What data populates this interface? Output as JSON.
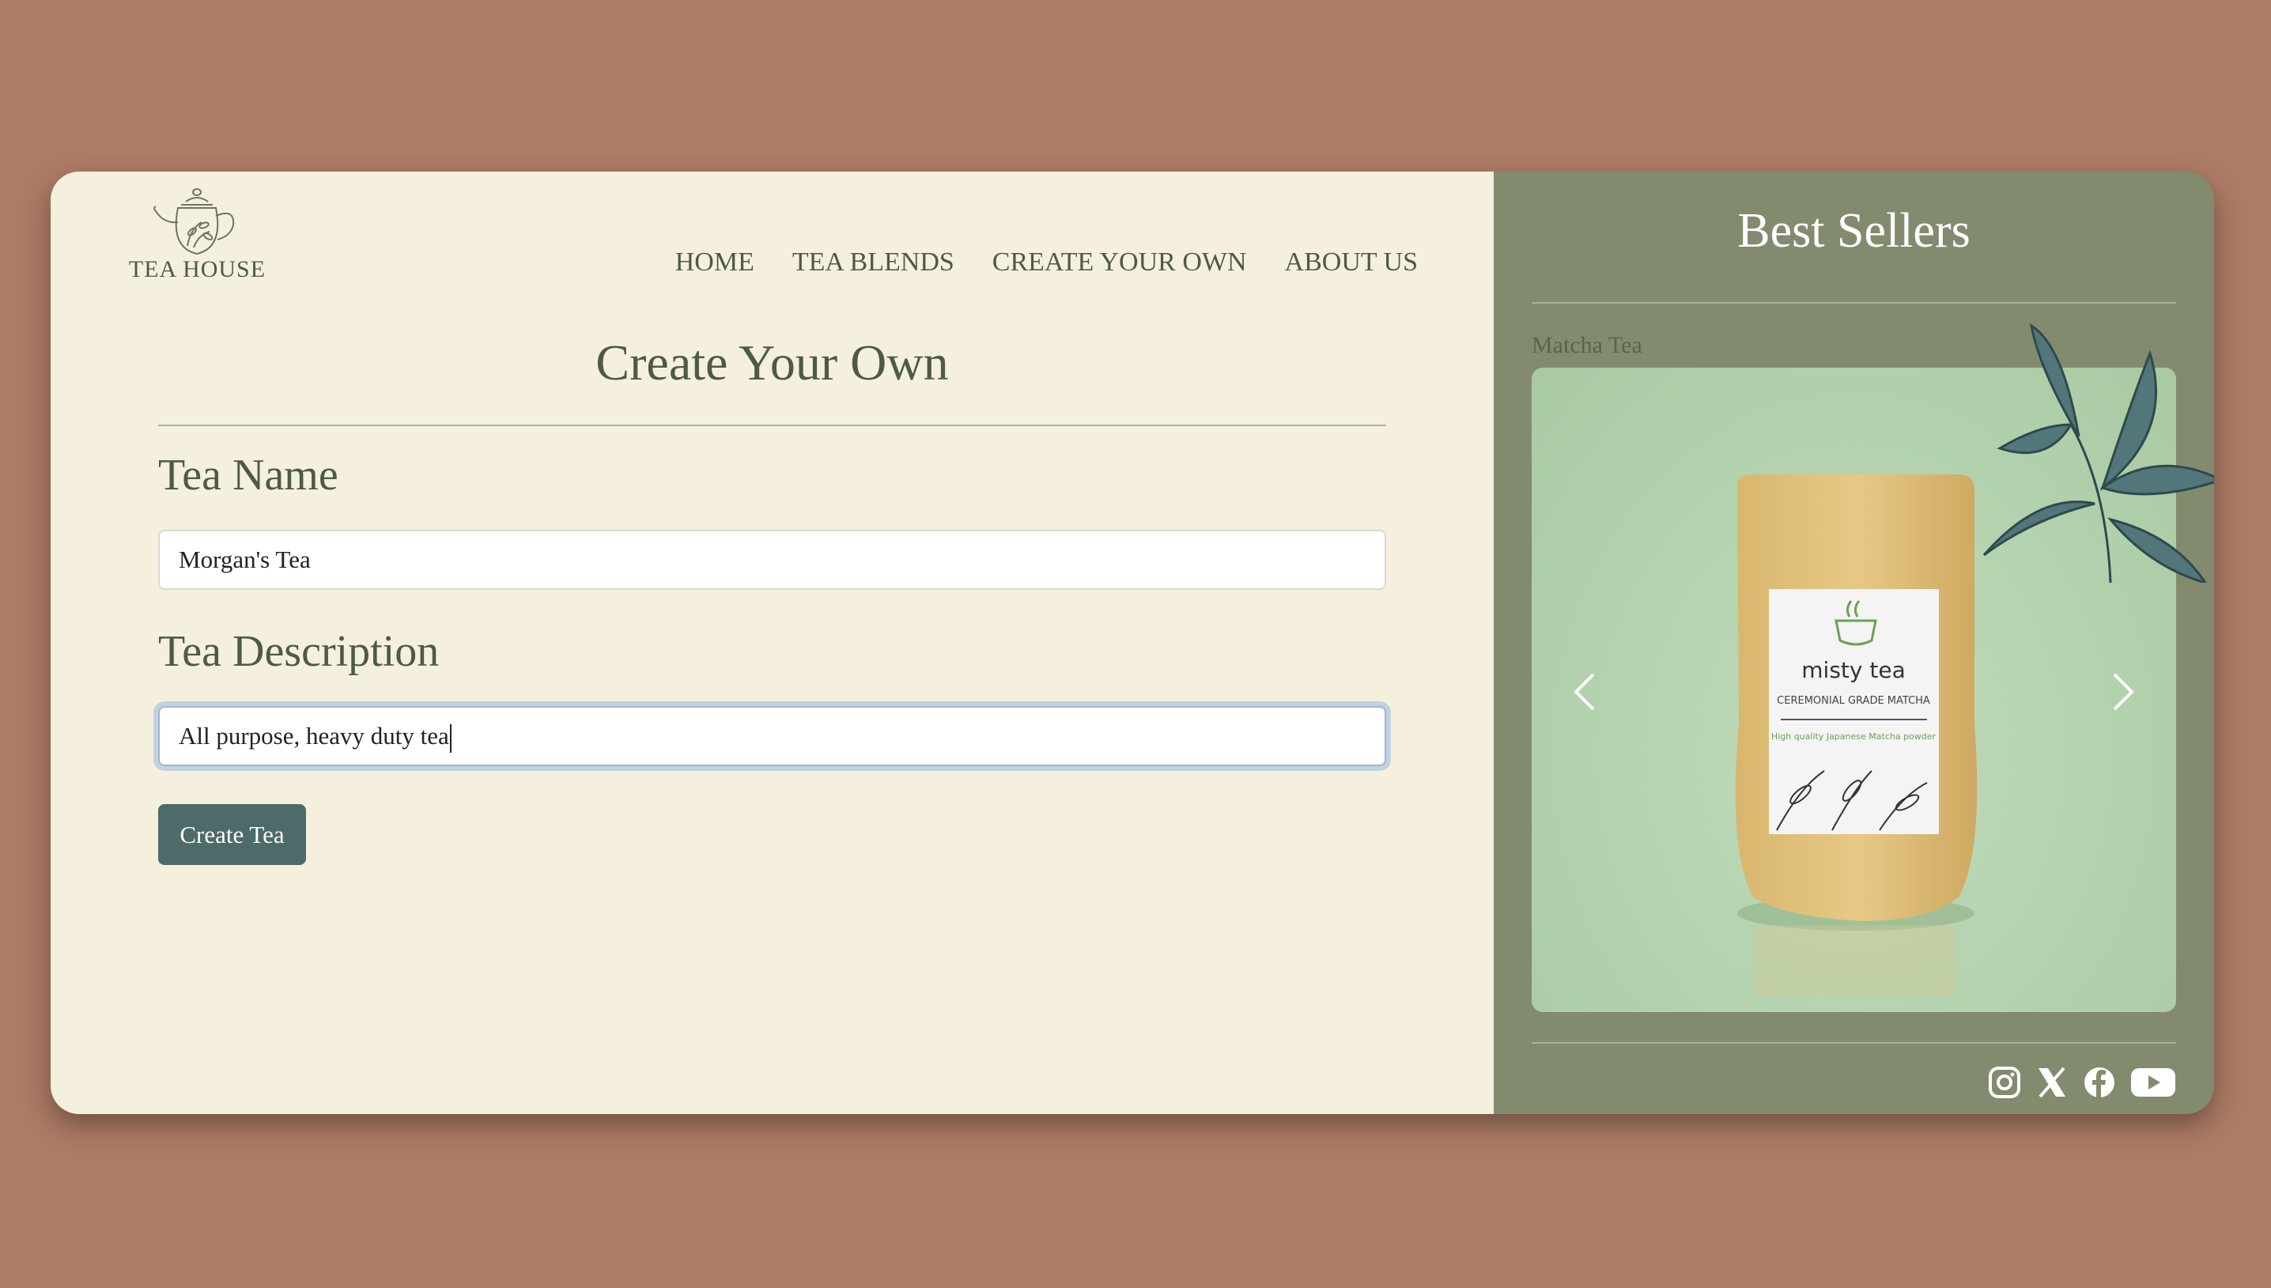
{
  "brand": {
    "name": "TEA HOUSE"
  },
  "nav": {
    "items": [
      {
        "label": "HOME"
      },
      {
        "label": "TEA BLENDS"
      },
      {
        "label": "CREATE YOUR OWN"
      },
      {
        "label": "ABOUT US"
      }
    ]
  },
  "form": {
    "title": "Create Your Own",
    "name_label": "Tea Name",
    "name_value": "Morgan's Tea",
    "description_label": "Tea Description",
    "description_value": "All purpose, heavy duty tea",
    "submit_label": "Create Tea"
  },
  "sidebar": {
    "title": "Best Sellers",
    "product": {
      "name": "Matcha Tea",
      "package_brand": "misty tea",
      "package_grade": "CEREMONIAL GRADE MATCHA",
      "package_desc": "High quality Japanese Matcha powder"
    },
    "socials": [
      "instagram-icon",
      "x-icon",
      "facebook-icon",
      "youtube-icon"
    ]
  },
  "colors": {
    "background": "#ad7b66",
    "left_panel": "#f5f0dd",
    "right_panel": "#838b6f",
    "text": "#4d5a45",
    "button": "#4d6b68",
    "carousel_bg": "#b3d2ae"
  }
}
